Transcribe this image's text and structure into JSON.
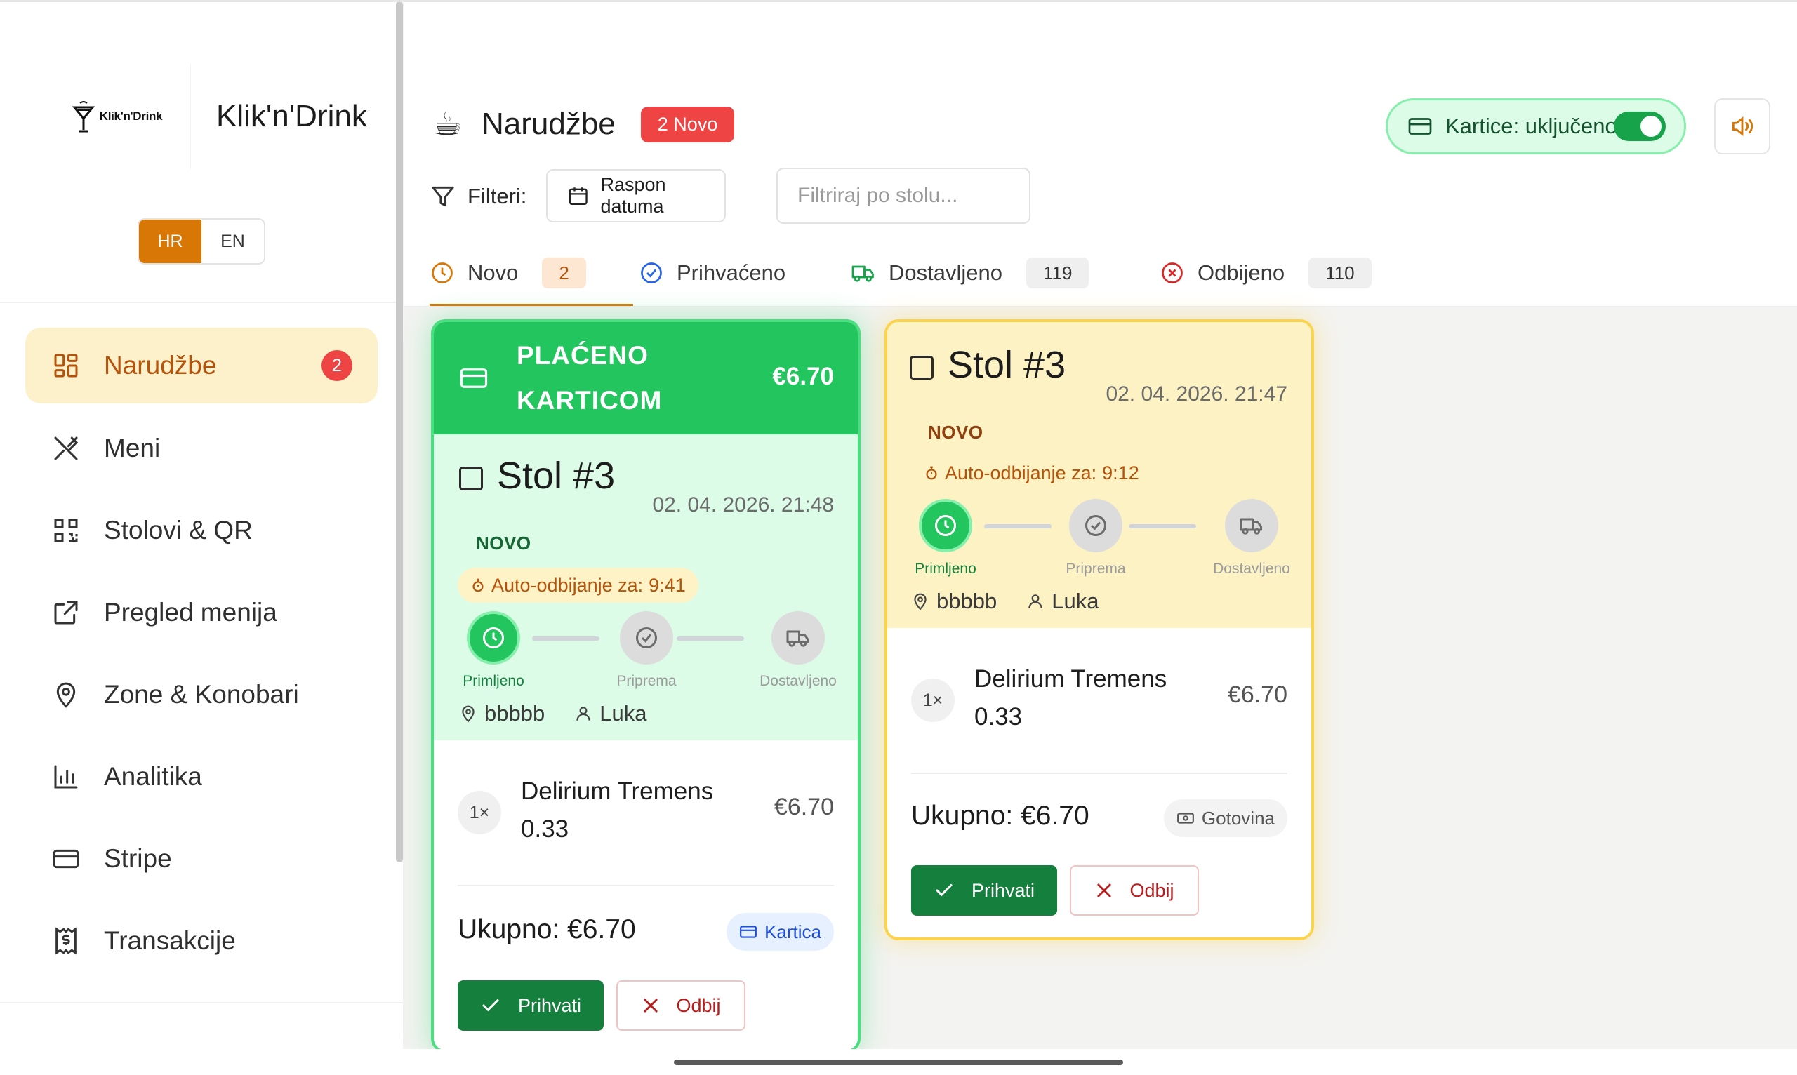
{
  "brand": {
    "logo_text": "Klik'n'Drink",
    "name": "Klik'n'Drink"
  },
  "language": {
    "active": "HR",
    "other": "EN"
  },
  "sidebar": {
    "items": [
      {
        "label": "Narudžbe",
        "icon": "grid-icon",
        "badge": "2",
        "active": true
      },
      {
        "label": "Meni",
        "icon": "utensils-icon"
      },
      {
        "label": "Stolovi & QR",
        "icon": "qr-code-icon"
      },
      {
        "label": "Pregled menija",
        "icon": "external-link-icon"
      },
      {
        "label": "Zone & Konobari",
        "icon": "map-pin-icon"
      },
      {
        "label": "Analitika",
        "icon": "bar-chart-icon"
      },
      {
        "label": "Stripe",
        "icon": "credit-card-icon"
      },
      {
        "label": "Transakcije",
        "icon": "receipt-dollar-icon"
      }
    ]
  },
  "header": {
    "title": "Narudžbe",
    "title_icon": "☕",
    "new_badge": "2 Novo",
    "cards_toggle_label": "Kartice: uključeno",
    "cards_toggle_on": true,
    "sound_icon": "speaker-icon"
  },
  "filters": {
    "label": "Filteri:",
    "date_range_label": "Raspon datuma",
    "table_placeholder": "Filtriraj po stolu..."
  },
  "tabs": [
    {
      "label": "Novo",
      "count": "2",
      "icon": "clock-icon",
      "active": true
    },
    {
      "label": "Prihvaćeno",
      "count": "",
      "icon": "check-circle-icon"
    },
    {
      "label": "Dostavljeno",
      "count": "119",
      "icon": "truck-icon"
    },
    {
      "label": "Odbijeno",
      "count": "110",
      "icon": "x-circle-icon"
    }
  ],
  "orders": [
    {
      "paid_banner": "PLAĆENO KARTICOM",
      "paid_amount": "€6.70",
      "table": "Stol #3",
      "datetime": "02. 04. 2026. 21:48",
      "status": "NOVO",
      "auto_reject_label": "Auto-odbijanje za:",
      "auto_reject_time": "9:41",
      "steps": [
        "Primljeno",
        "Priprema",
        "Dostavljeno"
      ],
      "location": "bbbbb",
      "waiter": "Luka",
      "items": [
        {
          "qty": "1×",
          "name": "Delirium Tremens 0.33",
          "price": "€6.70"
        }
      ],
      "total": "Ukupno: €6.70",
      "payment": "Kartica",
      "accept_label": "Prihvati",
      "reject_label": "Odbij"
    },
    {
      "table": "Stol #3",
      "datetime": "02. 04. 2026. 21:47",
      "status": "NOVO",
      "auto_reject_label": "Auto-odbijanje za:",
      "auto_reject_time": "9:12",
      "steps": [
        "Primljeno",
        "Priprema",
        "Dostavljeno"
      ],
      "location": "bbbbb",
      "waiter": "Luka",
      "items": [
        {
          "qty": "1×",
          "name": "Delirium Tremens 0.33",
          "price": "€6.70"
        }
      ],
      "total": "Ukupno: €6.70",
      "payment": "Gotovina",
      "accept_label": "Prihvati",
      "reject_label": "Odbij"
    }
  ],
  "colors": {
    "accent": "#d97706",
    "accent_bg": "#fdf1cc",
    "danger": "#ef4444",
    "success": "#22c55e",
    "success_dark": "#15803d",
    "card_green_bg": "#dcfce7",
    "card_yellow_bg": "#fdf2c4"
  }
}
